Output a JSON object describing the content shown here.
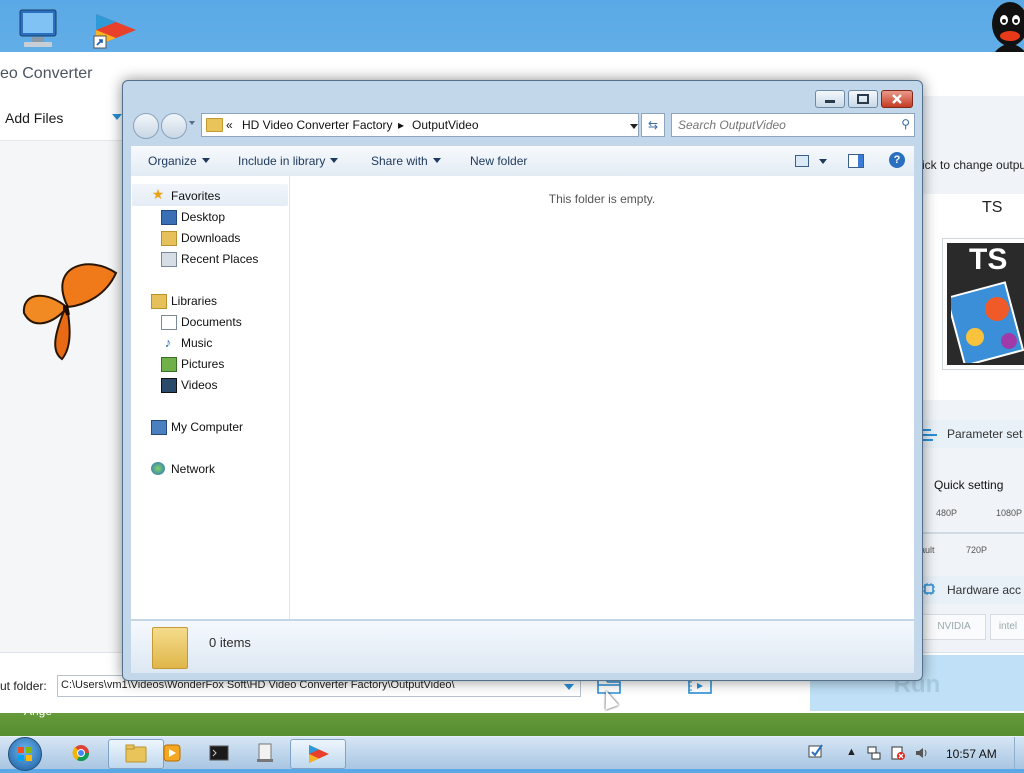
{
  "background_app": {
    "title": "eo Converter",
    "add_files_label": "Add Files",
    "right_panel": {
      "hint": "ick to change outpu",
      "format_name": "TS",
      "format_badge": "TS",
      "parameter_settings": "Parameter set",
      "quick_setting": "Quick setting",
      "ticks_top": [
        "480P",
        "1080P"
      ],
      "ticks_bottom": [
        "ault",
        "720P"
      ],
      "hardware_accel": "Hardware acc",
      "brand_nvidia": "NVIDIA",
      "brand_intel": "intel"
    },
    "output_folder_label": "ut folder:",
    "output_folder_path": "C:\\Users\\vm1\\Videos\\WonderFox Soft\\HD Video Converter Factory\\OutputVideo\\",
    "run_label": "Run",
    "desktop_label": "Ange"
  },
  "explorer": {
    "breadcrumb": [
      "«",
      "HD Video Converter Factory",
      "▸",
      "OutputVideo"
    ],
    "search_placeholder": "Search OutputVideo",
    "commands": [
      "Organize",
      "Include in library",
      "Share with",
      "New folder"
    ],
    "nav": {
      "favorites": "Favorites",
      "favorites_items": [
        "Desktop",
        "Downloads",
        "Recent Places"
      ],
      "libraries": "Libraries",
      "libraries_items": [
        "Documents",
        "Music",
        "Pictures",
        "Videos"
      ],
      "computer": "My Computer",
      "network": "Network"
    },
    "empty_message": "This folder is empty.",
    "item_count": "0 items"
  },
  "taskbar": {
    "clock": "10:57 AM"
  }
}
